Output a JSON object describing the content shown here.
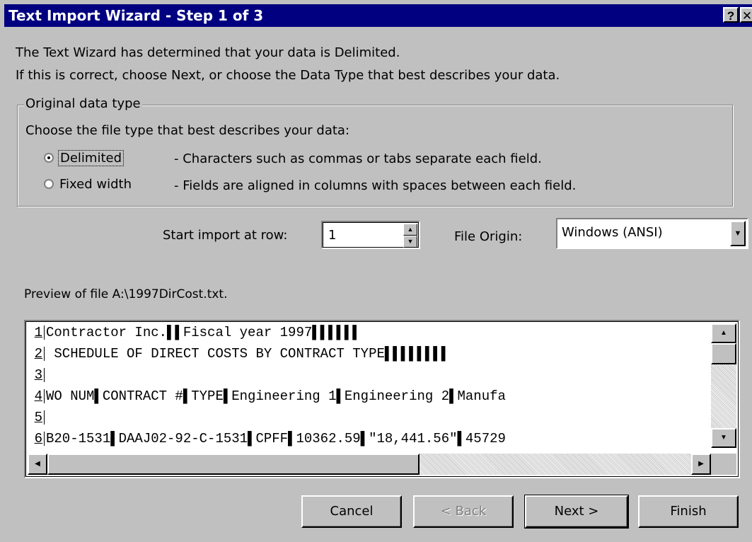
{
  "window": {
    "title": "Text Import Wizard - Step 1 of 3",
    "help_glyph": "?",
    "close_glyph": "✕"
  },
  "intro": {
    "line1": "The Text Wizard has determined that your data is Delimited.",
    "line2": "If this is correct, choose Next, or choose the Data Type that best describes your data."
  },
  "data_type": {
    "group_label": "Original data type",
    "prompt": "Choose the file type that best describes your data:",
    "options": [
      {
        "label": "Delimited",
        "description": "- Characters such as commas or tabs separate each field.",
        "selected": true
      },
      {
        "label": "Fixed width",
        "description": "- Fields are aligned in columns with spaces between each field.",
        "selected": false
      }
    ]
  },
  "import_start": {
    "label": "Start import at row:",
    "value": "1"
  },
  "file_origin": {
    "label": "File Origin:",
    "value": "Windows (ANSI)"
  },
  "preview": {
    "label": "Preview of file A:\\1997DirCost.txt.",
    "lines": [
      {
        "num": "1",
        "text": "Contractor Inc.▌▌Fiscal year 1997▌▌▌▌▌▌"
      },
      {
        "num": "2",
        "text": " SCHEDULE OF DIRECT COSTS BY CONTRACT TYPE▌▌▌▌▌▌▌▌"
      },
      {
        "num": "3",
        "text": ""
      },
      {
        "num": "4",
        "text": "WO NUM▌CONTRACT #▌TYPE▌Engineering 1▌Engineering 2▌Manufa"
      },
      {
        "num": "5",
        "text": ""
      },
      {
        "num": "6",
        "text": "B20-1531▌DAAJ02-92-C-1531▌CPFF▌10362.59▌\"18,441.56\"▌45729"
      }
    ]
  },
  "buttons": {
    "cancel": "Cancel",
    "back": "< Back",
    "next": "Next >",
    "finish": "Finish"
  }
}
